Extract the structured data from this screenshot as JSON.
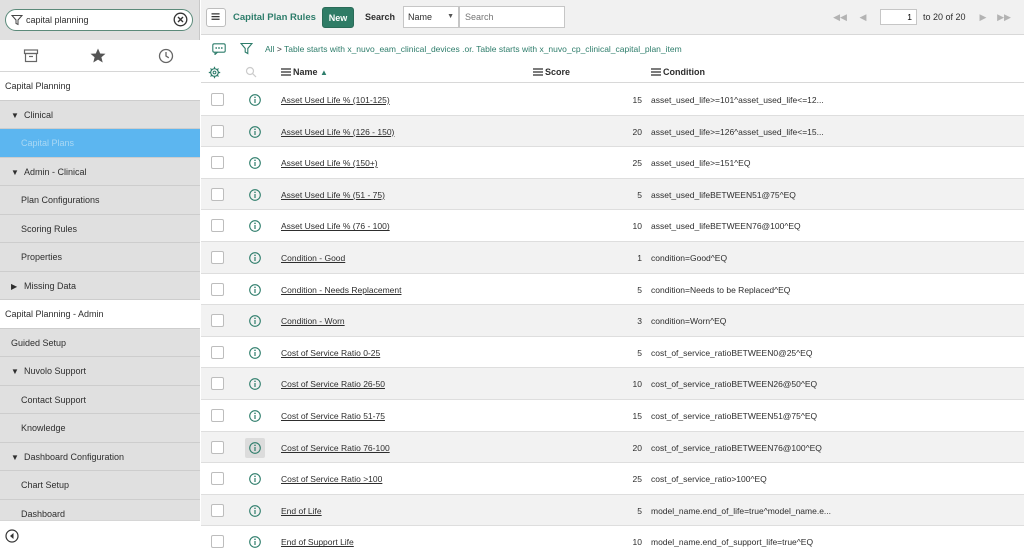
{
  "sidebar": {
    "filter": {
      "value": "capital planning"
    },
    "tabs": [
      {
        "icon": "archive-icon"
      },
      {
        "icon": "star-icon"
      },
      {
        "icon": "clock-icon"
      }
    ],
    "nav": [
      {
        "label": "Capital Planning",
        "level": 0,
        "kind": "app-header"
      },
      {
        "label": "Clinical",
        "level": 1,
        "kind": "section",
        "expanded": true
      },
      {
        "label": "Capital Plans",
        "level": 2,
        "kind": "module",
        "selected": true
      },
      {
        "label": "Admin - Clinical",
        "level": 1,
        "kind": "section",
        "expanded": true
      },
      {
        "label": "Plan Configurations",
        "level": 2,
        "kind": "module"
      },
      {
        "label": "Scoring Rules",
        "level": 2,
        "kind": "module"
      },
      {
        "label": "Properties",
        "level": 2,
        "kind": "module"
      },
      {
        "label": "Missing Data",
        "level": 1,
        "kind": "section",
        "expanded": false
      },
      {
        "label": "Capital Planning - Admin",
        "level": 0,
        "kind": "app-header"
      },
      {
        "label": "Guided Setup",
        "level": 1,
        "kind": "module"
      },
      {
        "label": "Nuvolo Support",
        "level": 1,
        "kind": "section",
        "expanded": true
      },
      {
        "label": "Contact Support",
        "level": 2,
        "kind": "module"
      },
      {
        "label": "Knowledge",
        "level": 2,
        "kind": "module"
      },
      {
        "label": "Dashboard Configuration",
        "level": 1,
        "kind": "section",
        "expanded": true
      },
      {
        "label": "Chart Setup",
        "level": 2,
        "kind": "module"
      },
      {
        "label": "Dashboard",
        "level": 2,
        "kind": "module"
      }
    ]
  },
  "toolbar": {
    "title": "Capital Plan Rules",
    "new_label": "New",
    "search_label": "Search",
    "search_field": "Name",
    "search_placeholder": "Search",
    "page_value": "1",
    "page_of": "to 20 of 20"
  },
  "breadcrumb": {
    "all": "All",
    "sep": ">",
    "condition": "Table starts with x_nuvo_eam_clinical_devices .or. Table starts with x_nuvo_cp_clinical_capital_plan_item"
  },
  "columns": {
    "name": "Name",
    "name_sort": "▲",
    "score": "Score",
    "condition": "Condition"
  },
  "rows": [
    {
      "name": "Asset Used Life % (101-125)",
      "score": "15",
      "condition": "asset_used_life>=101^asset_used_life<=12..."
    },
    {
      "name": "Asset Used Life % (126 - 150)",
      "score": "20",
      "condition": "asset_used_life>=126^asset_used_life<=15..."
    },
    {
      "name": "Asset Used Life % (150+)",
      "score": "25",
      "condition": "asset_used_life>=151^EQ"
    },
    {
      "name": "Asset Used Life % (51 - 75)",
      "score": "5",
      "condition": "asset_used_lifeBETWEEN51@75^EQ"
    },
    {
      "name": "Asset Used Life % (76 - 100)",
      "score": "10",
      "condition": "asset_used_lifeBETWEEN76@100^EQ"
    },
    {
      "name": "Condition - Good",
      "score": "1",
      "condition": "condition=Good^EQ"
    },
    {
      "name": "Condition - Needs Replacement",
      "score": "5",
      "condition": "condition=Needs to be Replaced^EQ"
    },
    {
      "name": "Condition - Worn",
      "score": "3",
      "condition": "condition=Worn^EQ"
    },
    {
      "name": "Cost of Service Ratio 0-25",
      "score": "5",
      "condition": "cost_of_service_ratioBETWEEN0@25^EQ"
    },
    {
      "name": "Cost of Service Ratio 26-50",
      "score": "10",
      "condition": "cost_of_service_ratioBETWEEN26@50^EQ"
    },
    {
      "name": "Cost of Service Ratio 51-75",
      "score": "15",
      "condition": "cost_of_service_ratioBETWEEN51@75^EQ"
    },
    {
      "name": "Cost of Service Ratio 76-100",
      "score": "20",
      "condition": "cost_of_service_ratioBETWEEN76@100^EQ",
      "hover": true
    },
    {
      "name": "Cost of Service Ratio >100",
      "score": "25",
      "condition": "cost_of_service_ratio>100^EQ"
    },
    {
      "name": "End of Life",
      "score": "5",
      "condition": "model_name.end_of_life=true^model_name.e..."
    },
    {
      "name": "End of Support Life",
      "score": "10",
      "condition": "model_name.end_of_support_life=true^EQ"
    }
  ],
  "colors": {
    "accent": "#2f7c66",
    "selected_nav": "#5cb6f0",
    "link_green": "#2e7d6b"
  }
}
